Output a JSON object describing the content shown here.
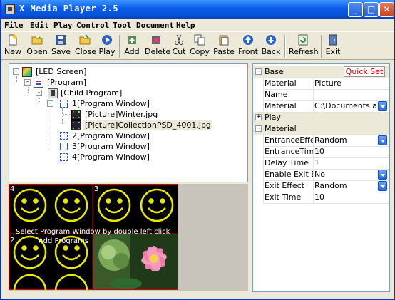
{
  "titlebar": {
    "title": "X Media Player 2.5",
    "min": "_",
    "max": "□",
    "close": "✕"
  },
  "menu": [
    "File",
    "Edit",
    "Play",
    "Control",
    "Tool",
    "Document",
    "Help"
  ],
  "toolbar": [
    "New",
    "Open",
    "Save",
    "Close",
    "Play",
    "Add",
    "Delete",
    "Cut",
    "Copy",
    "Paste",
    "Front",
    "Back",
    "Refresh",
    "Exit"
  ],
  "tree": [
    {
      "label": "[LED Screen]",
      "sign": "-"
    },
    {
      "label": "[Program]",
      "sign": "-"
    },
    {
      "label": "[Child Program]",
      "sign": "-"
    },
    {
      "label": "1[Program Window]",
      "sign": "-"
    },
    {
      "label": "[Picture]Winter.jpg"
    },
    {
      "label": "[Picture]CollectionPSD_4001.jpg"
    },
    {
      "label": "2[Program Window]"
    },
    {
      "label": "3[Program Window]"
    },
    {
      "label": "4[Program Window]"
    }
  ],
  "preview": {
    "hint_line1": "Select Program Window by double left click",
    "hint_line2": "Add Programs",
    "window_nums": [
      "4",
      "3",
      "2"
    ]
  },
  "props": {
    "quick_set": "Quick Set",
    "cat_base": "Base",
    "cat_play": "Play",
    "cat_material": "Material",
    "rows": [
      {
        "name": "Material",
        "value": "Picture"
      },
      {
        "name": "Name",
        "value": ""
      },
      {
        "name": "Material",
        "value": "C:\\Documents and S"
      },
      {
        "name": "EntranceEffect",
        "value": "Random"
      },
      {
        "name": "EntranceTime",
        "value": "10"
      },
      {
        "name": "Delay Time",
        "value": "1"
      },
      {
        "name": "Enable Exit Eff",
        "value": "No"
      },
      {
        "name": "Exit Effect",
        "value": "Random"
      },
      {
        "name": "Exit Time",
        "value": "10"
      }
    ]
  },
  "colors": {
    "accent": "#0a5de8",
    "led_smile": "#e8e800",
    "led_grid": "#cc0000",
    "quick_set_text": "#cc0000"
  }
}
